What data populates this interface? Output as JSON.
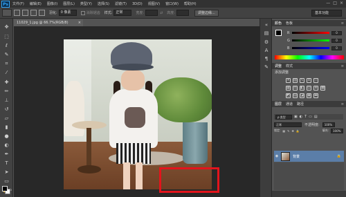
{
  "app": {
    "logo": "Ps"
  },
  "menu": [
    "文件(F)",
    "编辑(E)",
    "图像(I)",
    "图层(L)",
    "类型(Y)",
    "选择(S)",
    "滤镜(T)",
    "3D(D)",
    "视图(V)",
    "窗口(W)",
    "帮助(H)"
  ],
  "window_controls": [
    "—",
    "□",
    "×"
  ],
  "options": {
    "feather_label": "羽化:",
    "feather_value": "0 像素",
    "antialias_label": "消除锯齿",
    "style_label": "样式:",
    "style_value": "正常",
    "width_label": "宽度:",
    "height_label": "高度:",
    "refine_edge": "调整边缘...",
    "workspace": "基本功能"
  },
  "document": {
    "tab_title": "11029_1.jpg @ 66.7%(RGB/8)",
    "close": "×"
  },
  "color_panel": {
    "tabs": [
      "颜色",
      "色板"
    ],
    "sliders": [
      {
        "label": "R",
        "value": "0",
        "color": "#ff0000"
      },
      {
        "label": "G",
        "value": "0",
        "color": "#00ff00"
      },
      {
        "label": "B",
        "value": "0",
        "color": "#0000ff"
      }
    ]
  },
  "adjust_panel": {
    "tabs": [
      "调整",
      "样式"
    ],
    "title": "添加调整"
  },
  "layers_panel": {
    "tabs": [
      "图层",
      "通道",
      "路径"
    ],
    "kind_label": "ρ 类型",
    "blend_mode": "正常",
    "opacity_label": "不透明度:",
    "opacity_value": "100%",
    "lock_label": "锁定:",
    "fill_label": "填充:",
    "fill_value": "100%",
    "layers": [
      {
        "name": "背景",
        "visible": true,
        "locked": true
      }
    ]
  },
  "colors": {
    "selection_rect": "#e3141c",
    "layer_selected": "#5b7ea8"
  }
}
